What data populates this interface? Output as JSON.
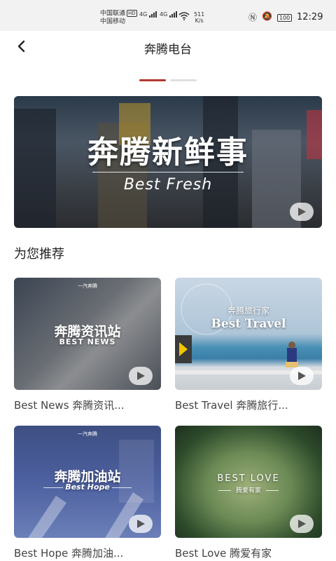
{
  "status_bar": {
    "carrier1": "中国联通",
    "hd": "HD",
    "carrier2": "中国移动",
    "net1": "4G",
    "net2": "4G",
    "speed_value": "511",
    "speed_unit": "K/s",
    "battery": "100",
    "time": "12:29"
  },
  "header": {
    "title": "奔腾电台"
  },
  "banner": {
    "title": "奔腾新鲜事",
    "subtitle": "Best Fresh"
  },
  "section": {
    "title": "为您推荐"
  },
  "cards": [
    {
      "label": "Best News 奔腾资讯...",
      "brand": "一汽奔腾",
      "cn": "奔腾资讯站",
      "en": "BEST NEWS"
    },
    {
      "label": "Best Travel 奔腾旅行...",
      "cn": "奔腾旅行家",
      "en": "Best Travel"
    },
    {
      "label": "Best Hope 奔腾加油...",
      "brand": "一汽奔腾",
      "cn": "奔腾加油站",
      "en": "Best Hope"
    },
    {
      "label": "Best Love 腾爱有家",
      "cn": "腾爱有家",
      "en": "BEST LOVE"
    }
  ],
  "colors": {
    "accent": "#b03a2e"
  },
  "icons": {
    "back": "chevron-left-icon",
    "play": "play-icon"
  }
}
